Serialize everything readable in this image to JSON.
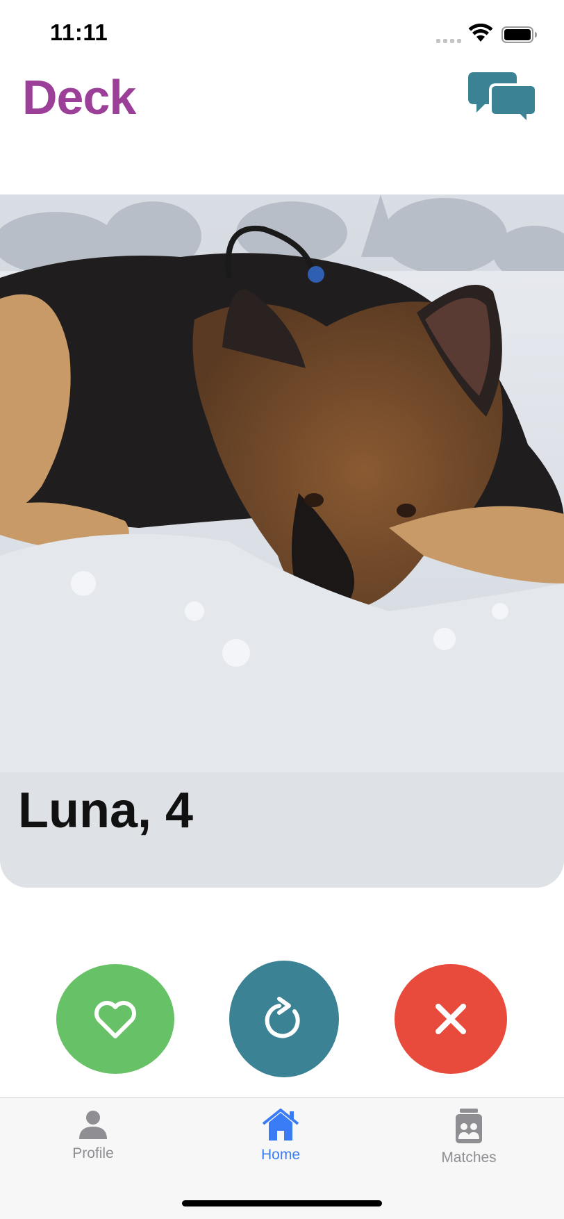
{
  "status_bar": {
    "time": "11:11",
    "icons": [
      "cellular-signal-icon",
      "wifi-icon",
      "battery-icon"
    ]
  },
  "header": {
    "title": "Deck",
    "title_color": "#9b3f98",
    "chat_icon": "chat-bubbles-icon",
    "chat_icon_color": "#3a8294"
  },
  "card": {
    "photo_subject": "dog-photo",
    "name_age": "Luna, 4"
  },
  "actions": {
    "like": {
      "icon": "heart-icon",
      "color": "#67c166"
    },
    "undo": {
      "icon": "redo-arrow-icon",
      "color": "#3a8294"
    },
    "nope": {
      "icon": "close-x-icon",
      "color": "#e84a3b"
    }
  },
  "tab_bar": {
    "active_color": "#3a7bf6",
    "inactive_color": "#8e8e93",
    "tabs": [
      {
        "label": "Profile",
        "icon": "person-icon",
        "active": false
      },
      {
        "label": "Home",
        "icon": "house-icon",
        "active": true
      },
      {
        "label": "Matches",
        "icon": "matches-jar-icon",
        "active": false
      }
    ]
  }
}
